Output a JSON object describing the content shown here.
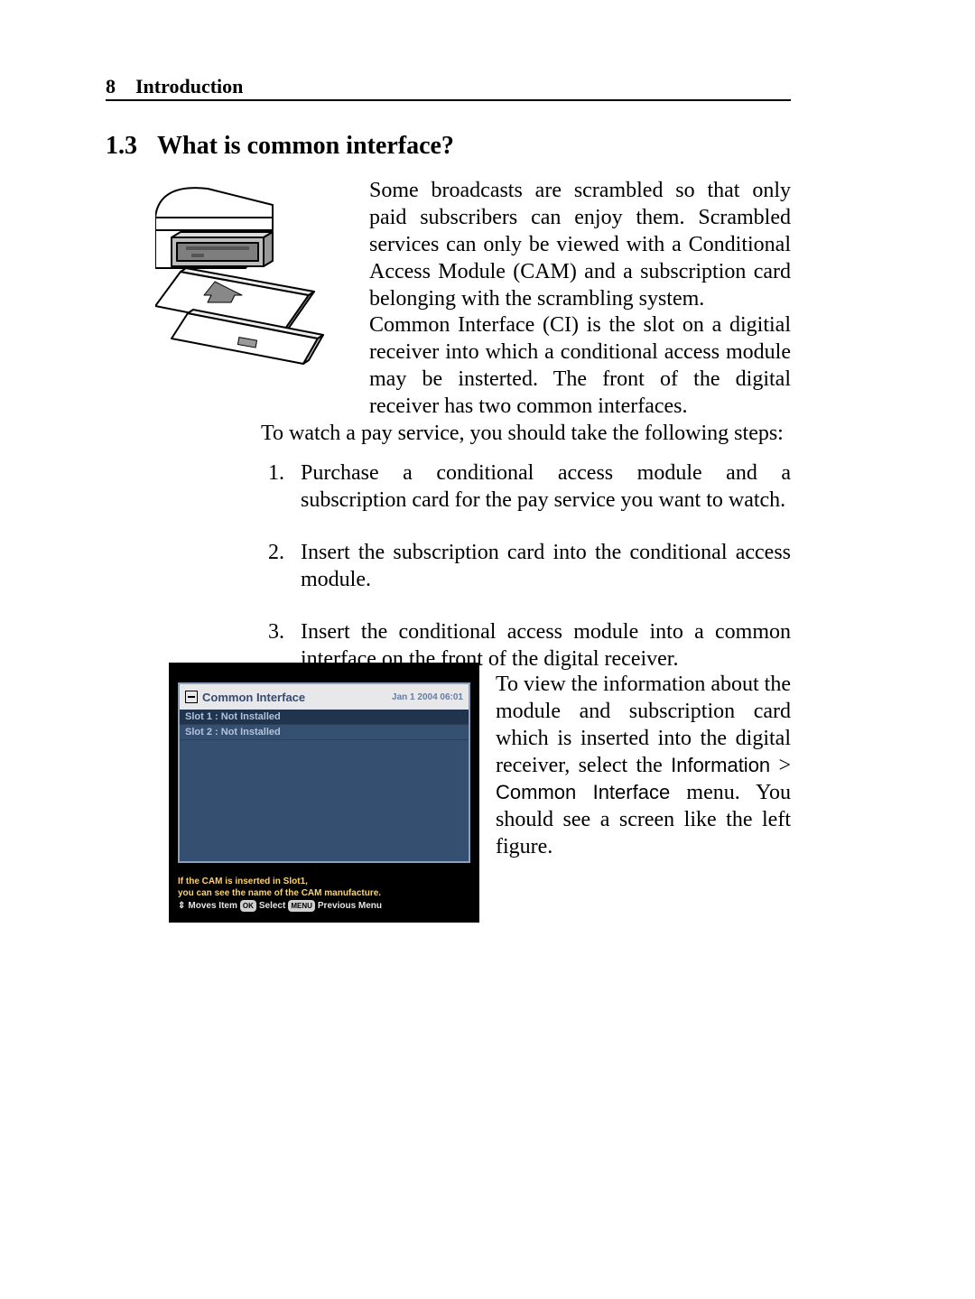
{
  "header": {
    "page_number": "8",
    "chapter": "Introduction"
  },
  "section": {
    "number": "1.3",
    "title": "What is common interface?"
  },
  "body": {
    "p1": "Some broadcasts are scrambled so that only paid subscribers can enjoy them. Scrambled services can only be viewed with a Conditional Access Module (CAM) and a subscription card belonging with the scrambling system.",
    "p2": "Common Interface (CI) is the slot on a digitial receiver into which a conditional access module may be insterted. The front of the digital receiver has two common interfaces.",
    "p3": "To watch a pay service, you should take the following steps:",
    "steps": [
      "Purchase a conditional access module and a subscription card for the pay service you want to watch.",
      "Insert the subscription card into the conditional access module.",
      "Insert the conditional access module into a common interface on the front of the digital receiver."
    ],
    "p4_pre": "To view the information about the module and subscription card which is inserted into the digital receiver, select the ",
    "p4_menu1": "Information",
    "p4_gt": ">",
    "p4_menu2": "Common Interface",
    "p4_post": " menu. You should see a screen like the left figure."
  },
  "ci_screenshot": {
    "title": "Common Interface",
    "timestamp": "Jan 1 2004 06:01",
    "slot1": "Slot 1 : Not Installed",
    "slot2": "Slot 2 : Not Installed",
    "footer_line1": "If the CAM is inserted in Slot1,",
    "footer_line2": "you can see the name of the CAM manufacture.",
    "nav_moves": "Moves Item",
    "nav_ok": "OK",
    "nav_select": "Select",
    "nav_menu": "MENU",
    "nav_prev": "Previous Menu"
  },
  "list_markers": {
    "n1": "1.",
    "n2": "2.",
    "n3": "3."
  }
}
